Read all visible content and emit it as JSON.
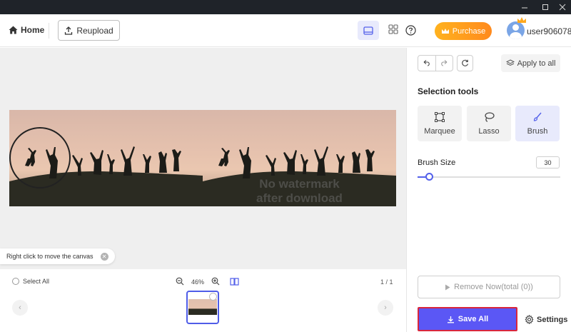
{
  "window": {
    "buttons": [
      "minimize",
      "maximize",
      "close"
    ]
  },
  "header": {
    "home_label": "Home",
    "reupload_label": "Reupload",
    "purchase_label": "Purchase",
    "username": "user906078",
    "accent_color": "#5b57f5",
    "purchase_color": "#ff9a1e"
  },
  "canvas": {
    "watermark_line1": "No watermark",
    "watermark_line2": "after download",
    "hint": "Right click to move the canvas"
  },
  "strip": {
    "select_all": "Select All",
    "zoom": "46%",
    "page_count": "1 / 1"
  },
  "panel": {
    "apply_all_label": "Apply to all",
    "selection_title": "Selection tools",
    "tools": [
      {
        "label": "Marquee",
        "icon": "marquee-icon",
        "active": false
      },
      {
        "label": "Lasso",
        "icon": "lasso-icon",
        "active": false
      },
      {
        "label": "Brush",
        "icon": "brush-icon",
        "active": true
      }
    ],
    "brush_size_label": "Brush Size",
    "brush_size_value": "30",
    "brush_size_fraction": 0.08,
    "remove_label": "Remove Now(total (0))",
    "save_label": "Save All",
    "settings_label": "Settings"
  }
}
